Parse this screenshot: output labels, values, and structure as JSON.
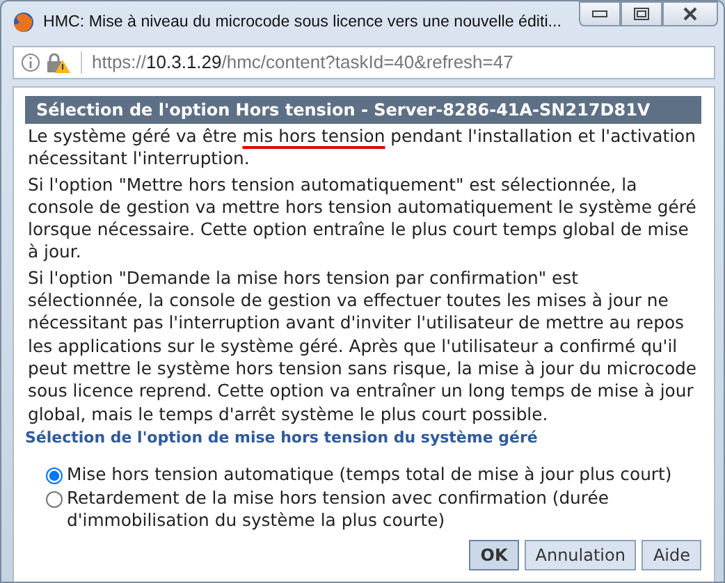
{
  "window": {
    "title": "HMC: Mise à niveau du microcode sous licence vers une nouvelle éditi..."
  },
  "address_bar": {
    "scheme": "https://",
    "host": "10.3.1.29",
    "path": "/hmc/content?taskId=40&refresh=47"
  },
  "header": "Sélection de l'option Hors tension - Server-8286-41A-SN217D81V",
  "intro": {
    "before": "Le système géré va être ",
    "marked": "mis hors tension",
    "after": " pendant l'installation et l'activation nécessitant l'interruption."
  },
  "paragraphs": [
    "Si l'option \"Mettre hors tension automatiquement\" est sélectionnée, la console de gestion va mettre hors tension automatiquement le système géré lorsque nécessaire. Cette option entraîne le plus court temps global de mise à jour.",
    "Si l'option \"Demande la mise hors tension par confirmation\" est sélectionnée, la console de gestion va effectuer toutes les mises à jour ne nécessitant pas l'interruption avant d'inviter l'utilisateur de mettre au repos les applications sur le système géré. Après que l'utilisateur a confirmé qu'il peut mettre le système hors tension sans risque, la mise à jour du microcode sous licence reprend. Cette option va entraîner un long temps de mise à jour global, mais le temps d'arrêt système le plus court possible."
  ],
  "section_title": "Sélection de l'option de mise hors tension du système géré",
  "options": [
    {
      "label": "Mise hors tension automatique (temps total de mise à jour plus court)",
      "selected": true
    },
    {
      "label": "Retardement de la mise hors tension avec confirmation (durée d'immobilisation du système la plus courte)",
      "selected": false
    }
  ],
  "buttons": [
    {
      "label": "OK",
      "kind": "default"
    },
    {
      "label": "Annulation",
      "kind": "normal"
    },
    {
      "label": "Aide",
      "kind": "normal"
    }
  ]
}
